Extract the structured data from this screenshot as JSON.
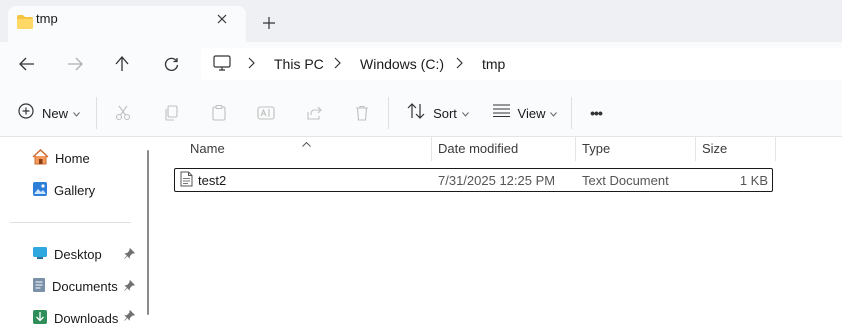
{
  "tab": {
    "title": "tmp",
    "close_icon": "close-icon",
    "new_tab_icon": "plus-icon"
  },
  "nav": {
    "back": "back-arrow-icon",
    "forward": "forward-arrow-icon",
    "up": "up-arrow-icon",
    "refresh": "refresh-icon"
  },
  "address": {
    "pc_icon": "monitor-icon",
    "crumbs": [
      "This PC",
      "Windows (C:)",
      "tmp"
    ]
  },
  "toolbar": {
    "new_label": "New",
    "sort_label": "Sort",
    "view_label": "View",
    "more_label": "•••"
  },
  "sidebar": {
    "items": [
      {
        "label": "Home",
        "icon": "home-icon"
      },
      {
        "label": "Gallery",
        "icon": "gallery-icon"
      },
      {
        "label": "Desktop",
        "icon": "desktop-icon",
        "pinned": true
      },
      {
        "label": "Documents",
        "icon": "documents-icon",
        "pinned": true
      },
      {
        "label": "Downloads",
        "icon": "downloads-icon",
        "pinned": true
      }
    ]
  },
  "columns": {
    "name": "Name",
    "date": "Date modified",
    "type": "Type",
    "size": "Size"
  },
  "files": [
    {
      "name": "test2",
      "date": "7/31/2025 12:25 PM",
      "type": "Text Document",
      "size": "1 KB",
      "icon": "text-file-icon"
    }
  ],
  "colors": {
    "accent": "#0067c0",
    "folder": "#f4c542",
    "tab_strip": "#eef0f4"
  }
}
